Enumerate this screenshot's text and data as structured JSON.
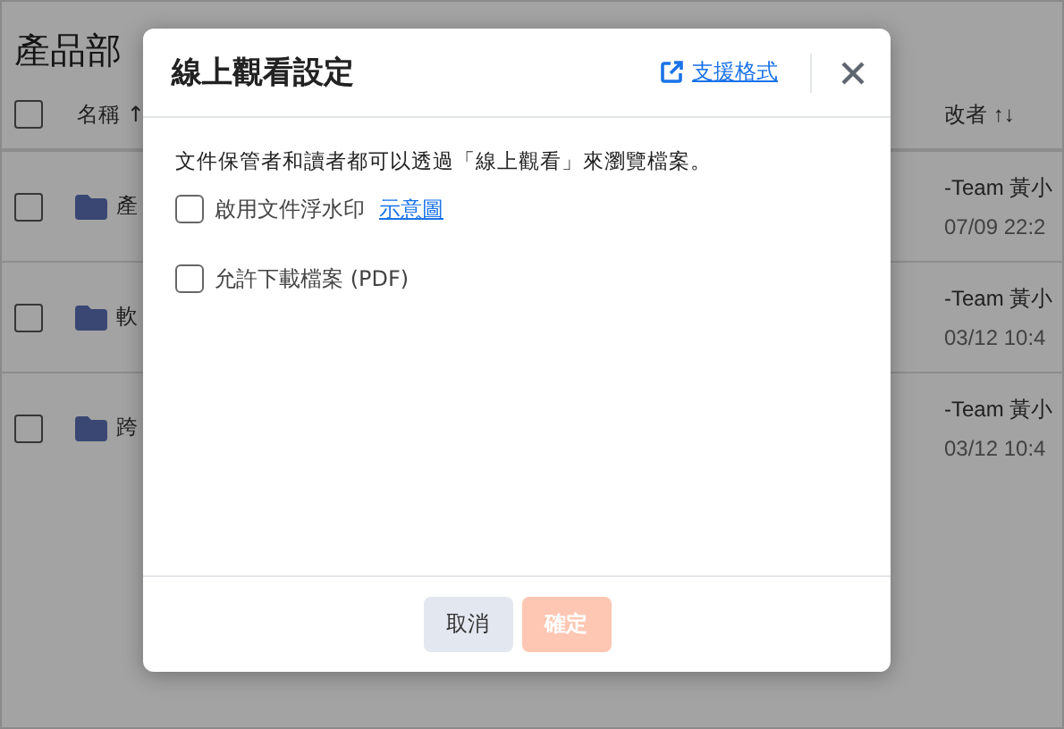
{
  "page": {
    "title": "產品部",
    "table": {
      "select_all": {
        "checked": false
      },
      "columns": [
        {
          "label": "名稱 ↑"
        },
        {
          "label": "改者 ↑↓"
        }
      ],
      "rows": [
        {
          "checked": false,
          "name": "產",
          "modifier": "-Team 黃小",
          "time": "07/09 22:2"
        },
        {
          "checked": false,
          "name": "軟",
          "modifier": "-Team 黃小",
          "time": "03/12 10:4"
        },
        {
          "checked": false,
          "name": "跨",
          "modifier": "-Team 黃小",
          "time": "03/12 10:4"
        }
      ]
    }
  },
  "dialog": {
    "title": "線上觀看設定",
    "help_link": "支援格式",
    "description": "文件保管者和讀者都可以透過「線上觀看」來瀏覽檔案。",
    "options": [
      {
        "label": "啟用文件浮水印",
        "checked": false,
        "link": "示意圖"
      },
      {
        "label": "允許下載檔案 (PDF)",
        "checked": false
      }
    ],
    "buttons": [
      {
        "label": "取消",
        "kind": "secondary",
        "disabled": false
      },
      {
        "label": "確定",
        "kind": "primary",
        "disabled": true
      }
    ]
  }
}
